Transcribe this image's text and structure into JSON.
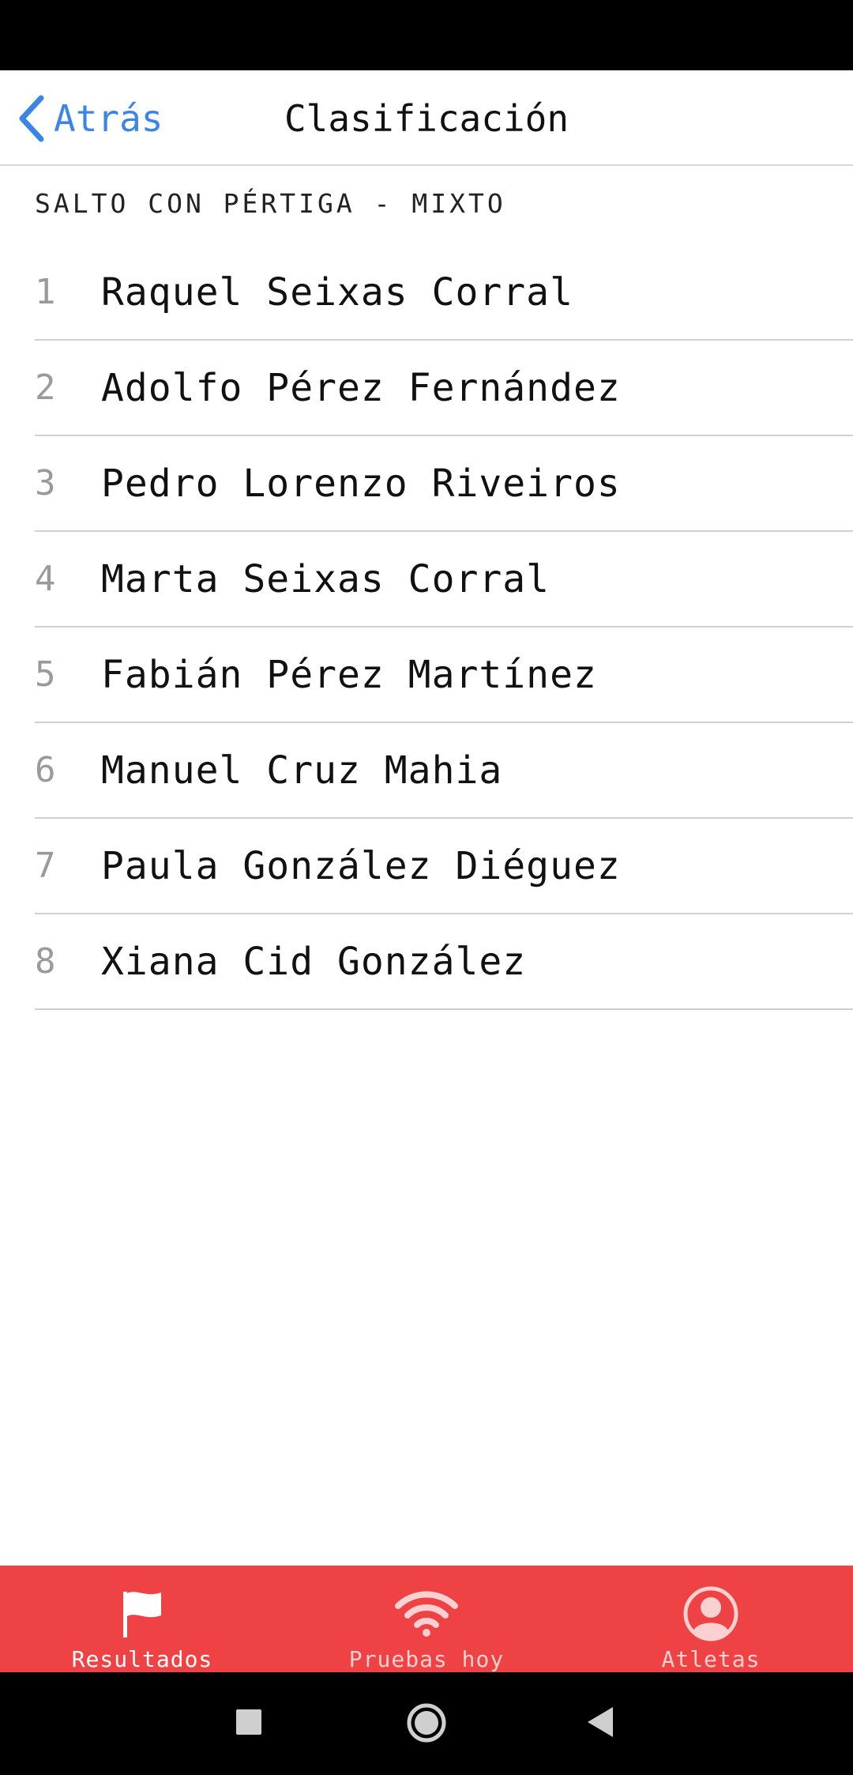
{
  "nav": {
    "back_label": "Atrás",
    "title": "Clasificación"
  },
  "section": {
    "header": "SALTO CON PÉRTIGA - MIXTO"
  },
  "ranking": [
    {
      "rank": "1",
      "name": "Raquel Seixas Corral"
    },
    {
      "rank": "2",
      "name": "Adolfo Pérez Fernández"
    },
    {
      "rank": "3",
      "name": "Pedro Lorenzo Riveiros"
    },
    {
      "rank": "4",
      "name": "Marta Seixas Corral"
    },
    {
      "rank": "5",
      "name": "Fabián Pérez Martínez"
    },
    {
      "rank": "6",
      "name": "Manuel Cruz Mahia"
    },
    {
      "rank": "7",
      "name": "Paula González Diéguez"
    },
    {
      "rank": "8",
      "name": "Xiana Cid González"
    }
  ],
  "tabbar": {
    "tabs": [
      {
        "label": "Resultados",
        "icon": "flag-icon",
        "active": true
      },
      {
        "label": "Pruebas hoy",
        "icon": "wifi-icon",
        "active": false
      },
      {
        "label": "Atletas",
        "icon": "user-icon",
        "active": false
      }
    ]
  },
  "colors": {
    "accent_blue": "#3a85e6",
    "tabbar_red": "#ef4244",
    "rank_gray": "#9a9a9a"
  }
}
